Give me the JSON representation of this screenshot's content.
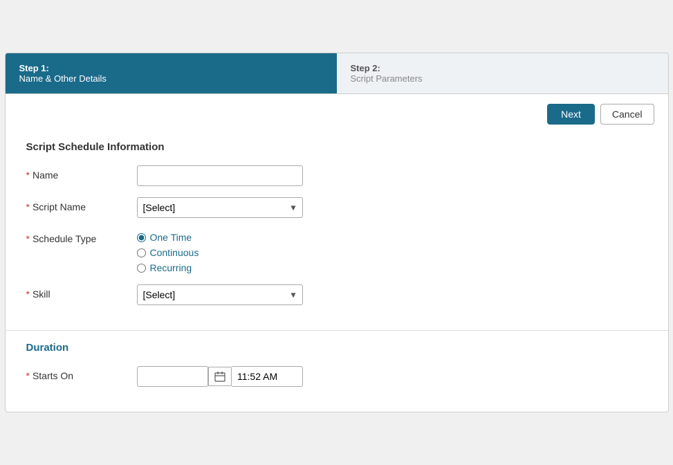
{
  "steps": [
    {
      "id": "step1",
      "number": "Step 1:",
      "name": "Name & Other Details",
      "active": true
    },
    {
      "id": "step2",
      "number": "Step 2:",
      "name": "Script Parameters",
      "active": false
    }
  ],
  "toolbar": {
    "next_label": "Next",
    "cancel_label": "Cancel"
  },
  "form_section": {
    "title": "Script Schedule Information",
    "fields": {
      "name": {
        "label": "Name",
        "placeholder": "",
        "required": true
      },
      "script_name": {
        "label": "Script Name",
        "required": true,
        "default_option": "[Select]",
        "options": [
          "[Select]"
        ]
      },
      "schedule_type": {
        "label": "Schedule Type",
        "required": true,
        "options": [
          {
            "value": "one_time",
            "label": "One Time",
            "checked": true
          },
          {
            "value": "continuous",
            "label": "Continuous",
            "checked": false
          },
          {
            "value": "recurring",
            "label": "Recurring",
            "checked": false
          }
        ]
      },
      "skill": {
        "label": "Skill",
        "required": true,
        "default_option": "[Select]",
        "options": [
          "[Select]"
        ]
      }
    }
  },
  "duration_section": {
    "title": "Duration",
    "starts_on": {
      "label": "Starts On",
      "required": true,
      "date_placeholder": "",
      "time_value": "11:52 AM"
    }
  }
}
